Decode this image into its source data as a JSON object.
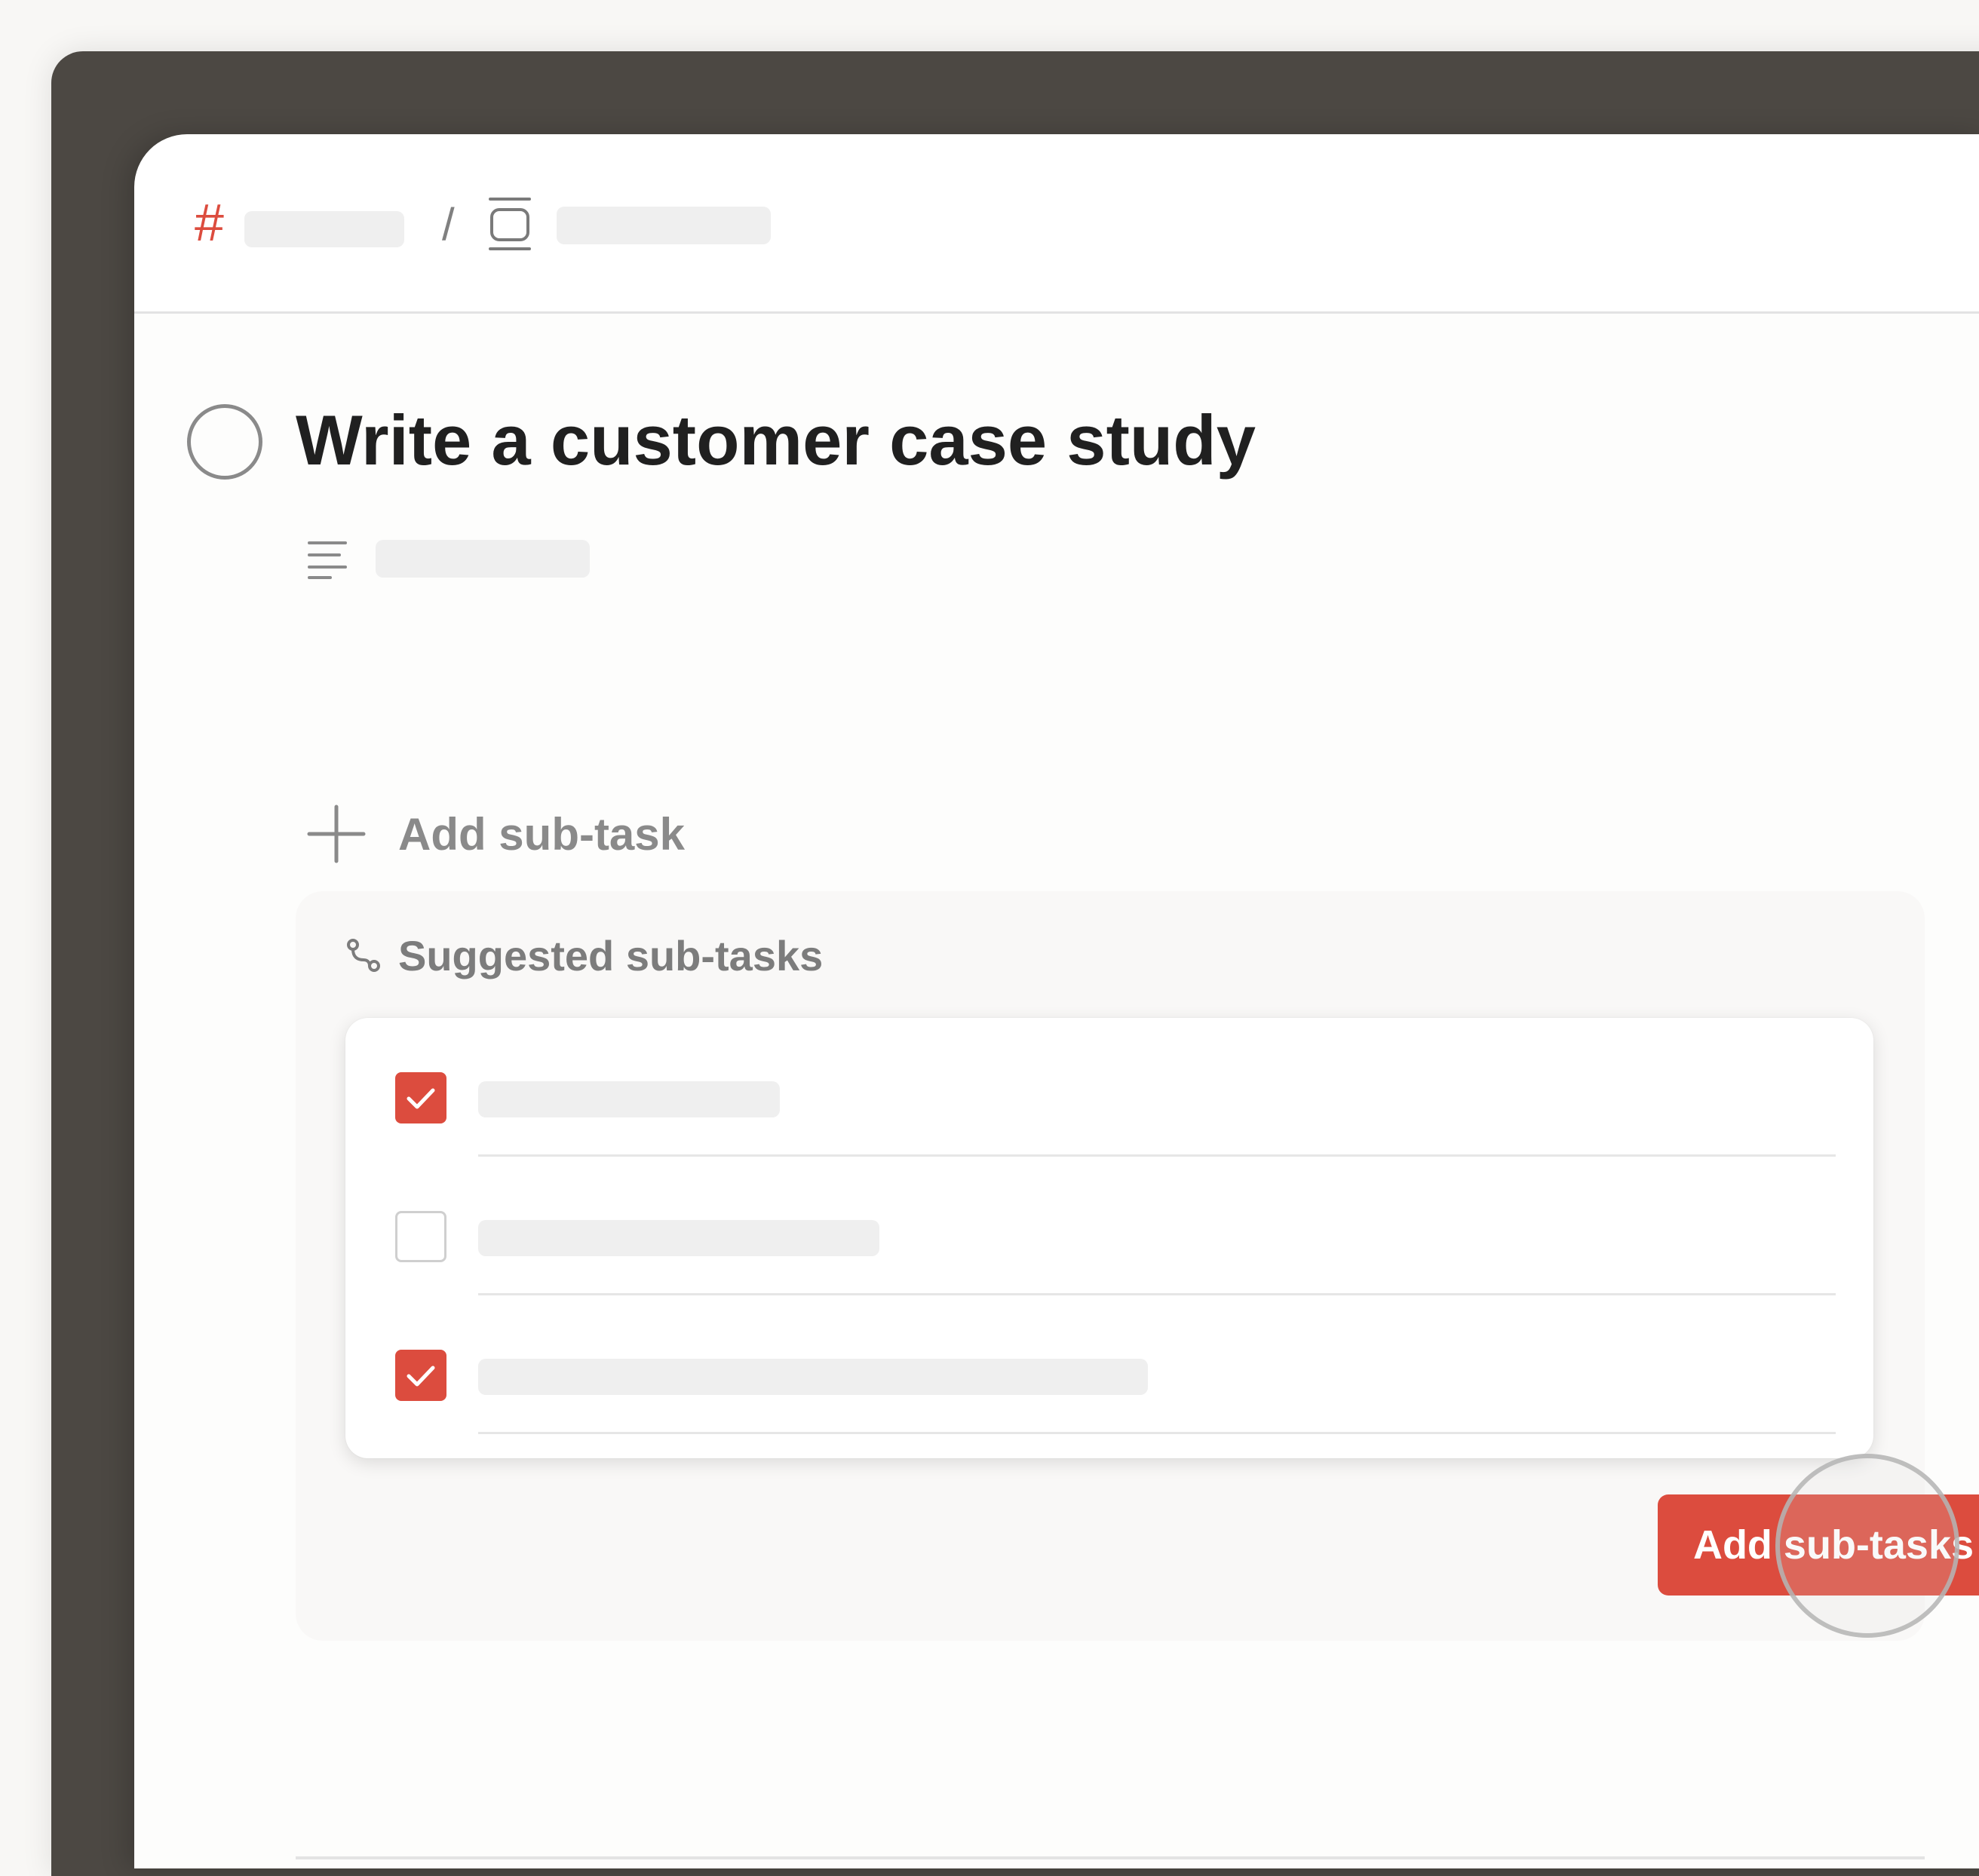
{
  "breadcrumb": {
    "project_icon": "hash-icon",
    "separator": "/",
    "section_icon": "section-icon"
  },
  "task": {
    "title": "Write a customer case study",
    "description_icon": "description-lines-icon"
  },
  "add_subtask": {
    "icon": "plus-icon",
    "label": "Add sub-task"
  },
  "suggestions": {
    "icon": "route-icon",
    "title": "Suggested sub-tasks",
    "items": [
      {
        "checked": true
      },
      {
        "checked": false
      },
      {
        "checked": true
      }
    ],
    "button_label": "Add sub-tasks"
  },
  "colors": {
    "accent": "#dc4c3e",
    "frame": "#4c4843",
    "text_primary": "#202020",
    "text_muted": "#8a8a8a"
  }
}
